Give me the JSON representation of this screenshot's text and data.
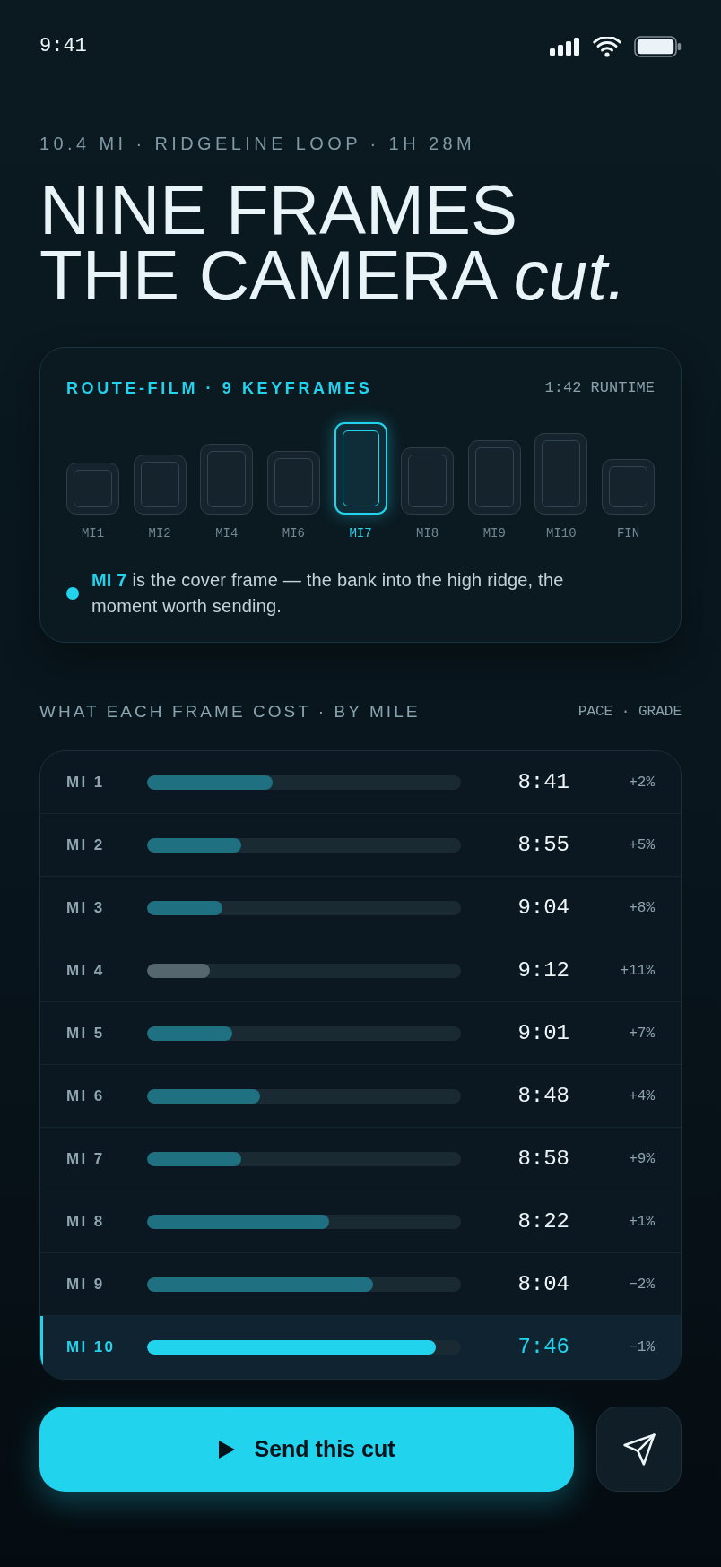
{
  "status_bar": {
    "time": "9:41"
  },
  "route": {
    "summary": "10.4 MI · RIDGELINE LOOP · 1H 28M",
    "headline": "NINE FRAMES\nTHE CAMERA *cut.*"
  },
  "film": {
    "title": "ROUTE-FILM · 9 KEYFRAMES",
    "runtime": "1:42 RUNTIME",
    "frames": [
      {
        "label": "MI1",
        "selected": false
      },
      {
        "label": "MI2",
        "selected": false
      },
      {
        "label": "MI4",
        "selected": false
      },
      {
        "label": "MI6",
        "selected": false
      },
      {
        "label": "MI7",
        "selected": true
      },
      {
        "label": "MI8",
        "selected": false
      },
      {
        "label": "MI9",
        "selected": false
      },
      {
        "label": "MI10",
        "selected": false
      },
      {
        "label": "FIN",
        "selected": false
      }
    ],
    "note": "**MI 7** is the cover frame — the bank into the high ridge, the moment worth sending."
  },
  "cost": {
    "title": "WHAT EACH FRAME COST · BY MILE",
    "legend": "PACE · GRADE",
    "rows": [
      {
        "mile": "MI 1",
        "level": 0.4,
        "color": "#1f7080",
        "pace": "8:41",
        "grade": "+2%",
        "selected": false
      },
      {
        "mile": "MI 2",
        "level": 0.3,
        "color": "#1f7080",
        "pace": "8:55",
        "grade": "+5%",
        "selected": false
      },
      {
        "mile": "MI 3",
        "level": 0.24,
        "color": "#1f7080",
        "pace": "9:04",
        "grade": "+8%",
        "selected": false
      },
      {
        "mile": "MI 4",
        "level": 0.2,
        "color": "#55666f",
        "pace": "9:12",
        "grade": "+11%",
        "selected": false
      },
      {
        "mile": "MI 5",
        "level": 0.27,
        "color": "#1f7080",
        "pace": "9:01",
        "grade": "+7%",
        "selected": false
      },
      {
        "mile": "MI 6",
        "level": 0.36,
        "color": "#1f7080",
        "pace": "8:48",
        "grade": "+4%",
        "selected": false
      },
      {
        "mile": "MI 7",
        "level": 0.3,
        "color": "#1f7080",
        "pace": "8:58",
        "grade": "+9%",
        "selected": false
      },
      {
        "mile": "MI 8",
        "level": 0.58,
        "color": "#1f7080",
        "pace": "8:22",
        "grade": "+1%",
        "selected": false
      },
      {
        "mile": "MI 9",
        "level": 0.72,
        "color": "#1f7080",
        "pace": "8:04",
        "grade": "−2%",
        "selected": false
      },
      {
        "mile": "MI 10",
        "level": 0.92,
        "color": "#22d3ee",
        "pace": "7:46",
        "grade": "−1%",
        "selected": true
      }
    ]
  },
  "actions": {
    "send_label": "Send this cut"
  }
}
